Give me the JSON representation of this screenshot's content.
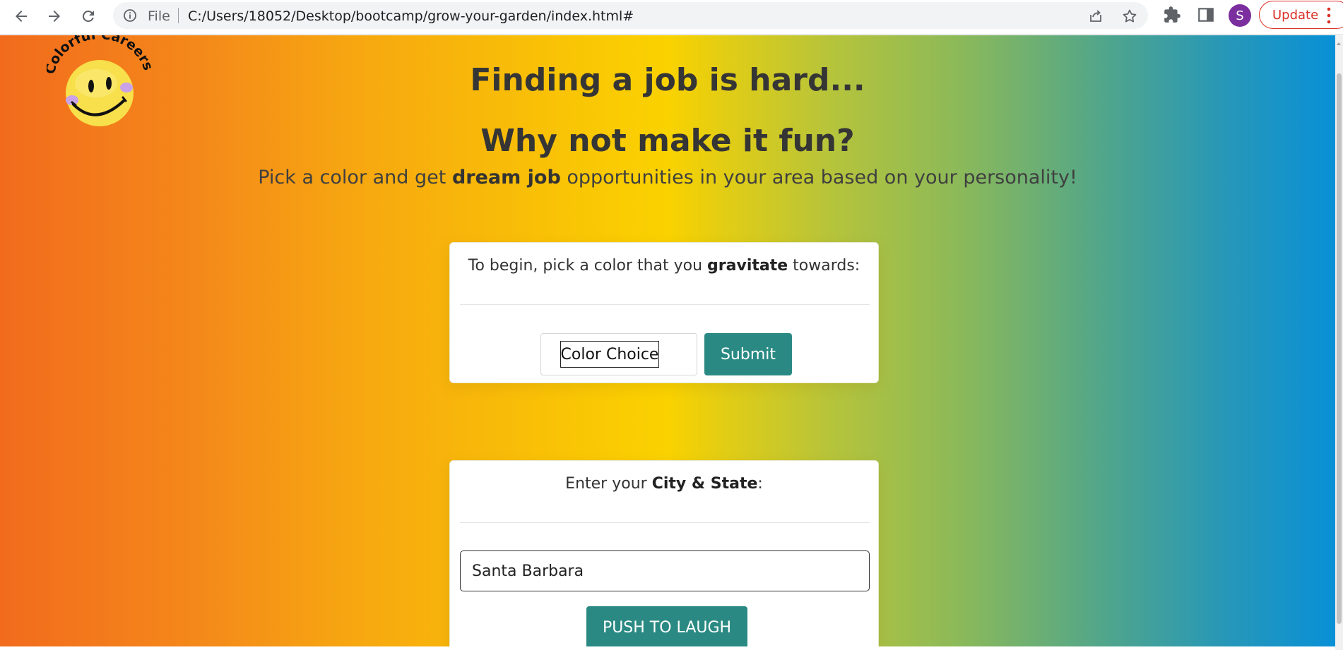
{
  "browser": {
    "file_label": "File",
    "url": "C:/Users/18052/Desktop/bootcamp/grow-your-garden/index.html#",
    "avatar_initial": "S",
    "update_label": "Update"
  },
  "logo": {
    "text": "Colorful Careers",
    "face_color": "#fbe14a"
  },
  "hero": {
    "title": "Finding a job is hard...",
    "subtitle": "Why not make it fun?",
    "description_pre": "Pick a color and get ",
    "description_bold": "dream job",
    "description_post": " opportunities in your area based on your personality!"
  },
  "color_card": {
    "prompt_pre": "To begin, pick a color that you ",
    "prompt_bold": "gravitate",
    "prompt_post": " towards:",
    "select_value": "Color Choice",
    "submit_label": "Submit"
  },
  "city_card": {
    "prompt_pre": "Enter your ",
    "prompt_bold": "City & State",
    "prompt_post": ":",
    "input_value": "Santa Barbara",
    "button_label": "PUSH TO LAUGH"
  },
  "colors": {
    "button_teal": "#2a8a83",
    "gradient": [
      "#f26b1d",
      "#f7a810",
      "#fad200",
      "#8bb95a",
      "#0990d6"
    ]
  }
}
